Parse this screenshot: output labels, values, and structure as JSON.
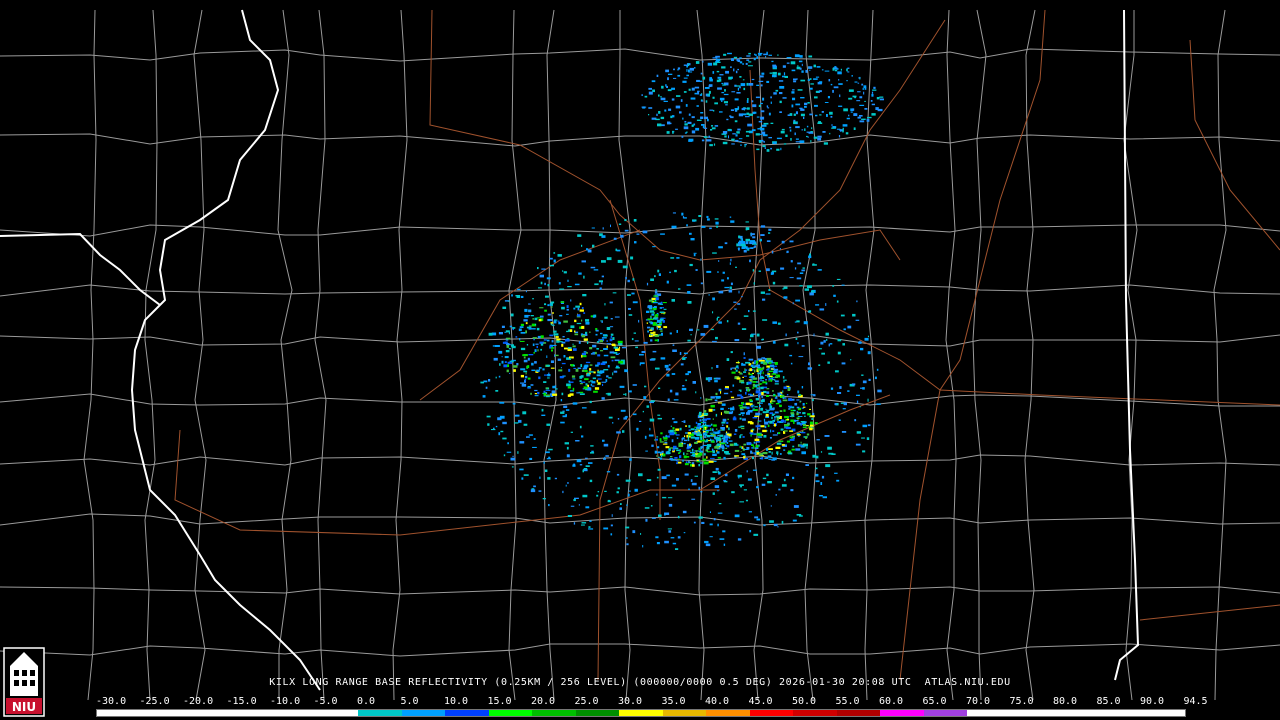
{
  "caption": "KILX LONG RANGE BASE REFLECTIVITY (0.25KM / 256 LEVEL) (000000/0000 0.5 DEG) 2026-01-30 20:08 UTC  ATLAS.NIU.EDU",
  "logo": {
    "text": "NIU",
    "color": "#c8102e"
  },
  "scale": {
    "ticks": [
      "-30.0",
      "-25.0",
      "-20.0",
      "-15.0",
      "-10.0",
      "-5.0",
      "0.0",
      "5.0",
      "10.0",
      "15.0",
      "20.0",
      "25.0",
      "30.0",
      "35.0",
      "40.0",
      "45.0",
      "50.0",
      "55.0",
      "60.0",
      "65.0",
      "70.0",
      "75.0",
      "80.0",
      "85.0",
      "90.0",
      "94.5"
    ],
    "colors": [
      "#ffffff",
      "#ffffff",
      "#ffffff",
      "#ffffff",
      "#ffffff",
      "#ffffff",
      "#00c8c8",
      "#00a0ff",
      "#0040ff",
      "#00ff00",
      "#00c000",
      "#009000",
      "#ffff00",
      "#e6b800",
      "#ff9000",
      "#ff0000",
      "#d00000",
      "#b00000",
      "#ff00ff",
      "#a040e0",
      "#ffffff",
      "#ffffff",
      "#ffffff",
      "#ffffff",
      "#ffffff"
    ]
  },
  "colors": {
    "background": "#000000",
    "county_lines": "#9a9a9a",
    "state_lines": "#ffffff",
    "highways": "#a0522d"
  }
}
